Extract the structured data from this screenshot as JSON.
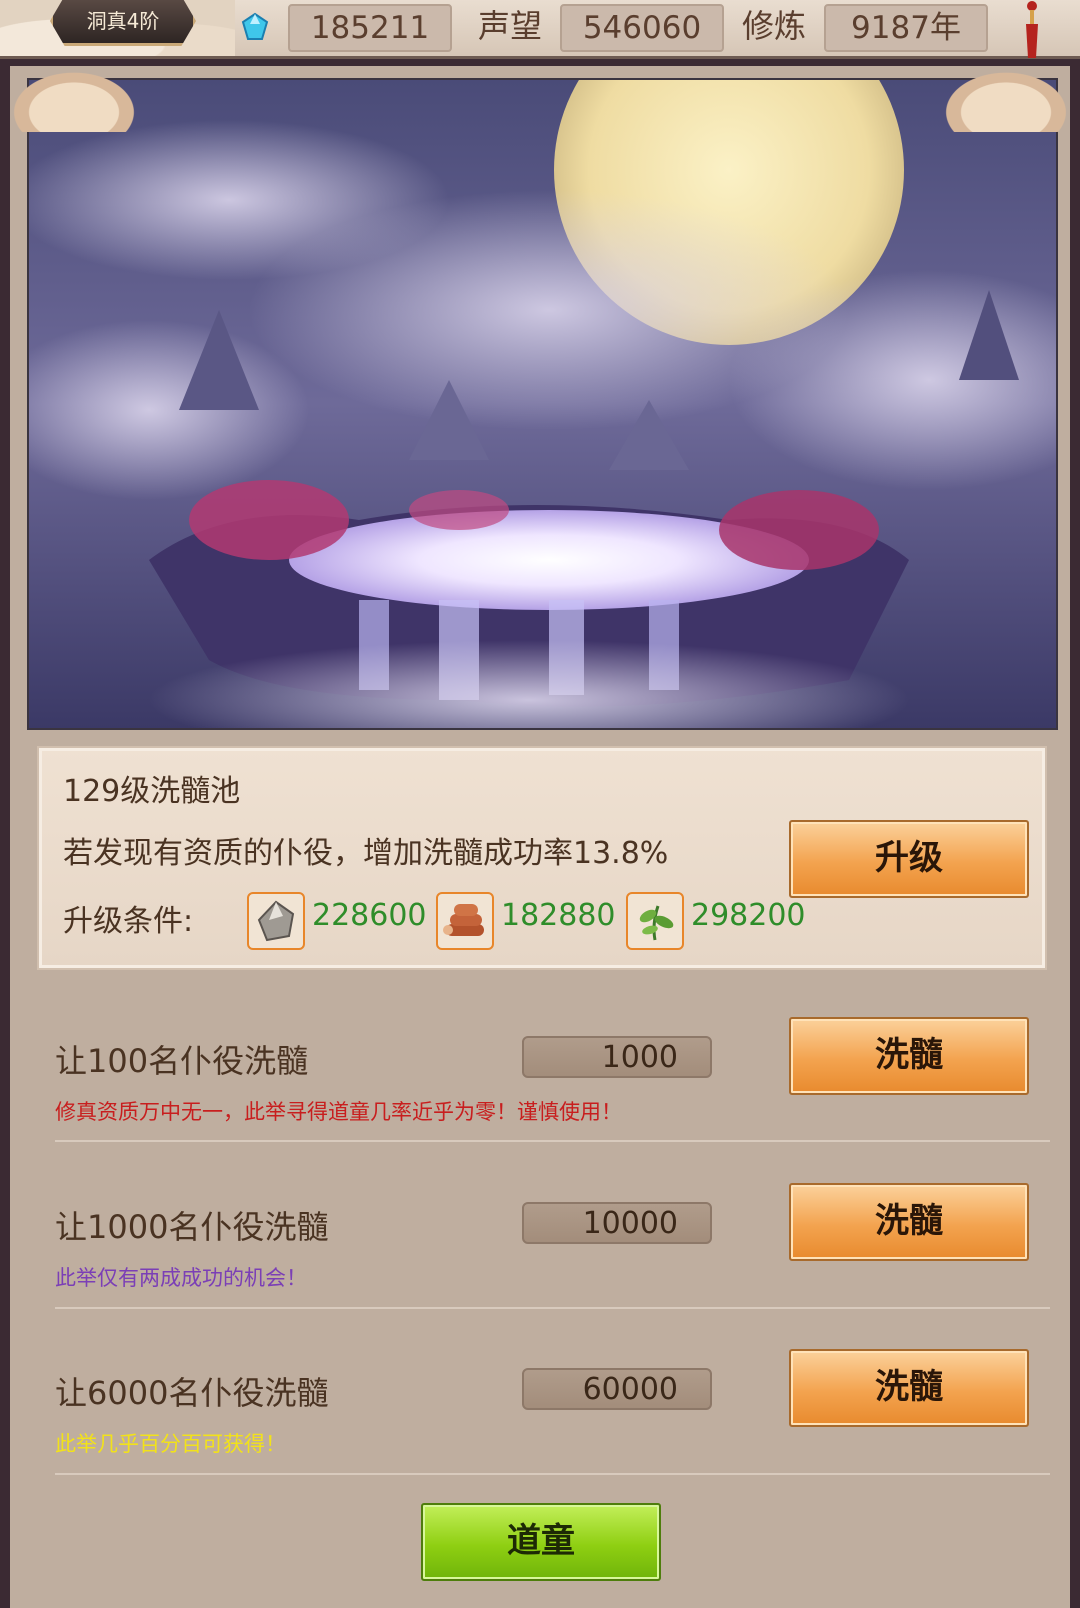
{
  "header": {
    "rank": "洞真4阶",
    "gems": "185211",
    "reputation_label": "声望",
    "reputation": "546060",
    "cultivation_label": "修炼",
    "cultivation": "9187年"
  },
  "pool": {
    "title": "129级洗髓池",
    "description": "若发现有资质的仆役，增加洗髓成功率13.8%",
    "upgrade_button": "升级",
    "requirements_label": "升级条件:",
    "requirements": [
      {
        "icon": "ore-icon",
        "value": "228600"
      },
      {
        "icon": "wood-icon",
        "value": "182880"
      },
      {
        "icon": "herb-icon",
        "value": "298200"
      }
    ]
  },
  "wash_rows": [
    {
      "label": "让100名仆役洗髓",
      "cost": "1000",
      "button": "洗髓",
      "note": "修真资质万中无一，此举寻得道童几率近乎为零！谨慎使用！",
      "note_color": "#c81e1e"
    },
    {
      "label": "让1000名仆役洗髓",
      "cost": "10000",
      "button": "洗髓",
      "note": "此举仅有两成成功的机会！",
      "note_color": "#7b3fb6"
    },
    {
      "label": "让6000名仆役洗髓",
      "cost": "60000",
      "button": "洗髓",
      "note": "此举几乎百分百可获得！",
      "note_color": "#f2e21a"
    }
  ],
  "footer_button": "道童"
}
